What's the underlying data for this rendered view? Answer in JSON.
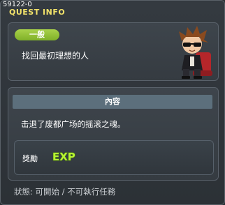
{
  "header": {
    "quest_id": "59122-0",
    "title": "QUEST INFO"
  },
  "quest": {
    "category": "一般",
    "name": "找回最初理想的人",
    "section_title": "內容",
    "description": "击退了废都广场的摇滚之魂。",
    "reward_label": "獎勵",
    "reward_exp_label": "EXP"
  },
  "footer": {
    "status": "狀態: 可開始 / 不可執行任務"
  },
  "colors": {
    "title": "#f2e26a",
    "badge": "#8fc035",
    "section_bar": "#5c6f7c",
    "exp_fill": "#b6f232"
  }
}
